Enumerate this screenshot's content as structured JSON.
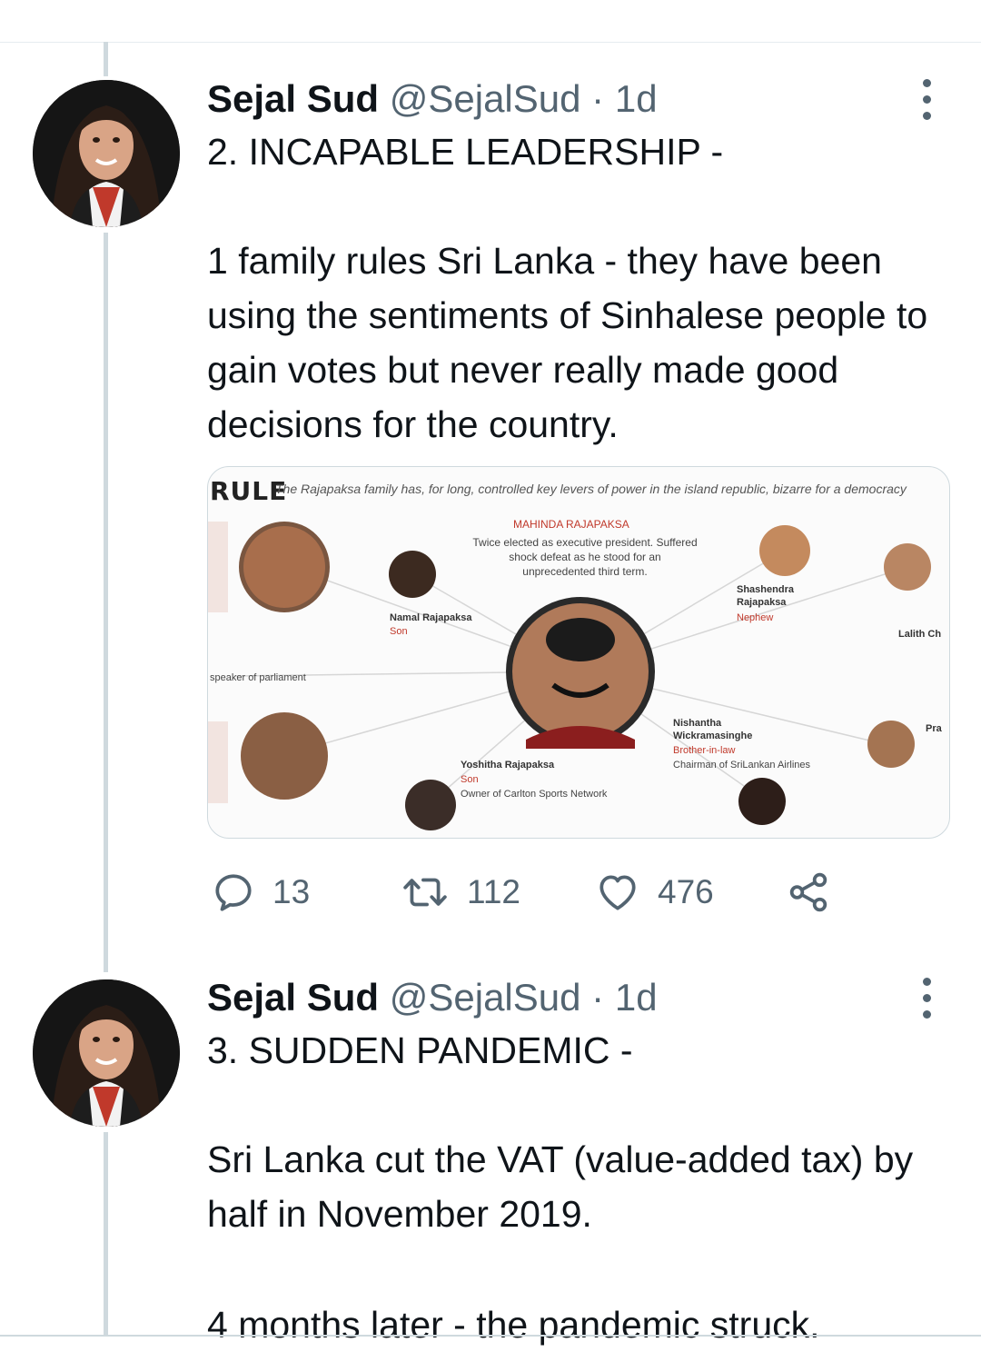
{
  "tweets": [
    {
      "author_name": "Sejal Sud",
      "handle": "@SejalSud",
      "separator": "·",
      "time": "1d",
      "title": "2. INCAPABLE LEADERSHIP -",
      "body": "1 family rules Sri Lanka - they have been using the sentiments of Sinhalese people to gain votes but never really made good decisions for the country.",
      "media": {
        "heading": "RULE",
        "subtitle": "The Rajapaksa family has, for long, controlled key levers of power in the island republic, bizarre for a democracy",
        "center_name": "MAHINDA RAJAPAKSA",
        "center_desc": "Twice elected as executive president. Suffered shock defeat as he stood for an unprecedented third term.",
        "labels": [
          "Namal Rajapaksa",
          "Son",
          "Shashendra Rajapaksa",
          "Nephew",
          "Nishantha Wickramasinghe",
          "Brother-in-law",
          "Chairman of SriLankan Airlines",
          "Yoshitha Rajapaksa",
          "Son",
          "Owner of Carlton Sports Network",
          "Lalith Ch",
          "speaker of parliament",
          "Pra"
        ]
      },
      "actions": {
        "replies": "13",
        "retweets": "112",
        "likes": "476"
      }
    },
    {
      "author_name": "Sejal Sud",
      "handle": "@SejalSud",
      "separator": "·",
      "time": "1d",
      "title": "3. SUDDEN PANDEMIC -",
      "body": "Sri Lanka cut the VAT (value-added tax) by half in November 2019.",
      "body_clipped": "4 months later - the pandemic struck."
    }
  ],
  "icons": {
    "reply": "speech-bubble-icon",
    "retweet": "retweet-icon",
    "like": "heart-icon",
    "share": "share-icon",
    "more": "more-vertical-icon"
  },
  "colors": {
    "text": "#0f1419",
    "secondary": "#536471",
    "thread": "#cfd9de"
  }
}
